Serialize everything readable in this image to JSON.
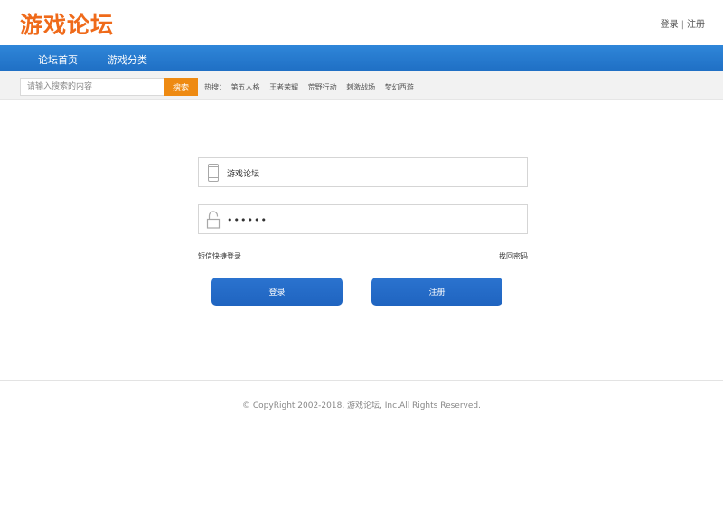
{
  "header": {
    "logo": "游戏论坛",
    "login_link": "登录",
    "separator": "|",
    "register_link": "注册"
  },
  "nav": {
    "items": [
      {
        "label": "论坛首页"
      },
      {
        "label": "游戏分类"
      }
    ]
  },
  "search": {
    "placeholder": "请输入搜索的内容",
    "button_label": "搜索",
    "hot_label": "热搜：",
    "hot_terms": [
      "第五人格",
      "王者荣耀",
      "荒野行动",
      "刺激战场",
      "梦幻西游"
    ]
  },
  "login_form": {
    "username_value": "游戏论坛",
    "password_value": "••••••",
    "sms_login_link": "短信快捷登录",
    "forgot_password_link": "找回密码",
    "login_button": "登录",
    "register_button": "注册",
    "icons": {
      "username": "phone-icon",
      "password": "unlock-icon"
    }
  },
  "footer": {
    "copyright": "© CopyRight 2002-2018, 游戏论坛, Inc.All Rights Reserved."
  },
  "colors": {
    "brand_orange": "#ef6a1a",
    "nav_blue": "#1f6fc4",
    "search_button": "#ee8a12",
    "button_blue": "#2468c6"
  }
}
